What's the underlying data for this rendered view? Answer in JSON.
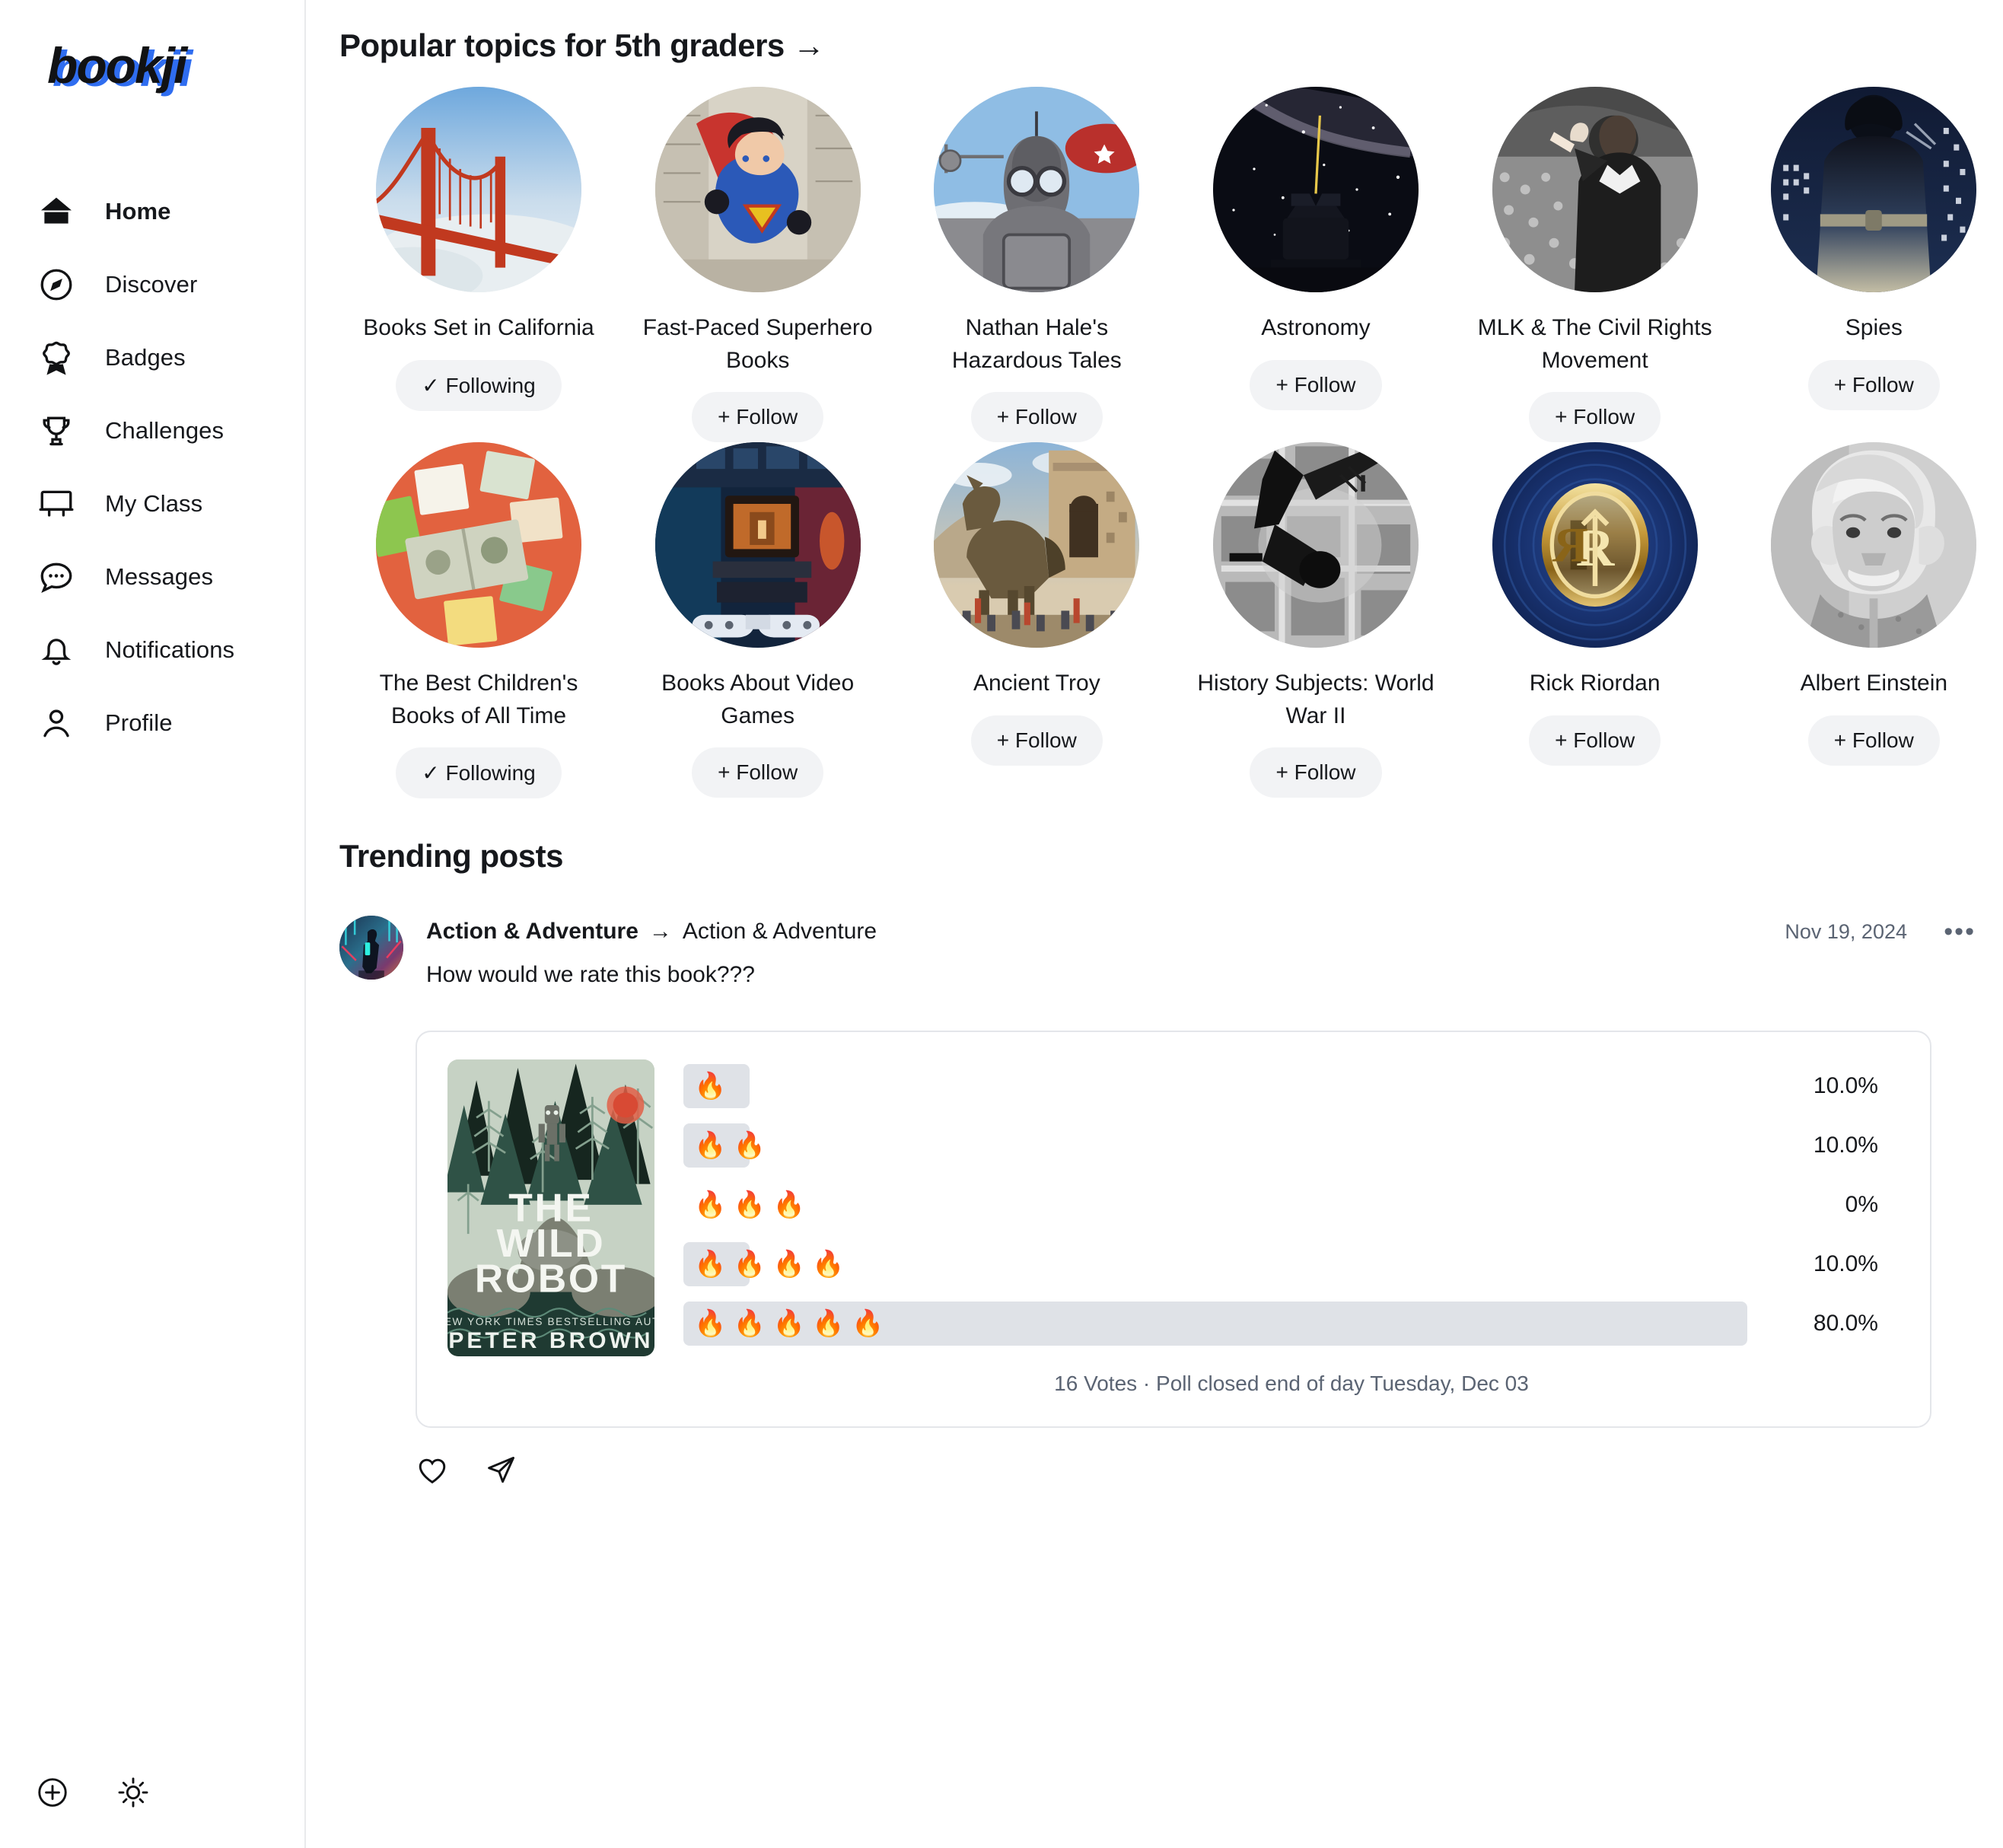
{
  "brand": {
    "name": "bookji",
    "logo_color": "#111214",
    "accent_color": "#2f6df0"
  },
  "sidebar": {
    "items": [
      {
        "label": "Home",
        "icon": "home-icon",
        "active": true
      },
      {
        "label": "Discover",
        "icon": "compass-icon",
        "active": false
      },
      {
        "label": "Badges",
        "icon": "badge-icon",
        "active": false
      },
      {
        "label": "Challenges",
        "icon": "trophy-icon",
        "active": false
      },
      {
        "label": "My Class",
        "icon": "whiteboard-icon",
        "active": false
      },
      {
        "label": "Messages",
        "icon": "chat-bubble-icon",
        "active": false
      },
      {
        "label": "Notifications",
        "icon": "bell-icon",
        "active": false
      },
      {
        "label": "Profile",
        "icon": "person-icon",
        "active": false
      }
    ],
    "bottom_icons": [
      "plus-circle-icon",
      "sun-icon"
    ]
  },
  "topics_section": {
    "heading": "Popular topics for 5th graders →",
    "follow_label": "+ Follow",
    "following_label": "✓ Following",
    "topics": [
      {
        "name": "Books Set in California",
        "state": "following",
        "button": "✓ Following",
        "art": "golden-gate-bridge"
      },
      {
        "name": "Fast-Paced Superhero Books",
        "state": "follow",
        "button": "+ Follow",
        "art": "superman"
      },
      {
        "name": "Nathan Hale's Hazardous Tales",
        "state": "follow",
        "button": "+ Follow",
        "art": "pilot-goggles"
      },
      {
        "name": "Astronomy",
        "state": "follow",
        "button": "+ Follow",
        "art": "observatory-night-sky"
      },
      {
        "name": "MLK & The Civil Rights Movement",
        "state": "follow",
        "button": "+ Follow",
        "art": "mlk-crowd"
      },
      {
        "name": "Spies",
        "state": "follow",
        "button": "+ Follow",
        "art": "spy-city-night"
      },
      {
        "name": "The Best Children's Books of All Time",
        "state": "following",
        "button": "✓ Following",
        "art": "childrens-books-orange"
      },
      {
        "name": "Books About Video Games",
        "state": "follow",
        "button": "+ Follow",
        "art": "retro-gaming-room"
      },
      {
        "name": "Ancient Troy",
        "state": "follow",
        "button": "+ Follow",
        "art": "trojan-horse"
      },
      {
        "name": "History Subjects: World War II",
        "state": "follow",
        "button": "+ Follow",
        "art": "wwii-aerial-bw"
      },
      {
        "name": "Rick Riordan",
        "state": "follow",
        "button": "+ Follow",
        "art": "rr-gold-emblem"
      },
      {
        "name": "Albert Einstein",
        "state": "follow",
        "button": "+ Follow",
        "art": "einstein-portrait"
      }
    ]
  },
  "trending_section": {
    "heading": "Trending posts",
    "post": {
      "author": "Action & Adventure",
      "arrow": "→",
      "target": "Action & Adventure",
      "date": "Nov 19, 2024",
      "more_glyph": "•••",
      "body": "How would we rate this book???",
      "book": {
        "title": "THE WILD ROBOT",
        "byline": "BY NEW YORK TIMES BESTSELLING AUTHOR",
        "author": "PETER BROWN"
      },
      "poll_footer": "16 Votes · Poll closed end of day Tuesday, Dec 03",
      "actions": [
        "heart-icon",
        "send-icon"
      ]
    }
  },
  "chart_data": {
    "type": "bar",
    "title": "How would we rate this book???",
    "orientation": "horizontal",
    "categories": [
      "🔥",
      "🔥 🔥",
      "🔥 🔥 🔥",
      "🔥 🔥 🔥 🔥",
      "🔥 🔥 🔥 🔥 🔥"
    ],
    "values": [
      10.0,
      10.0,
      0,
      10.0,
      80.0
    ],
    "labels": [
      "10.0%",
      "10.0%",
      "0%",
      "10.0%",
      "80.0%"
    ],
    "emoji_counts": [
      1,
      2,
      3,
      4,
      5
    ],
    "bar_color": "#dfe2e7",
    "total_votes": 16,
    "xlabel": "",
    "ylabel": "",
    "xlim": [
      0,
      100
    ],
    "grid": false,
    "legend": false
  }
}
